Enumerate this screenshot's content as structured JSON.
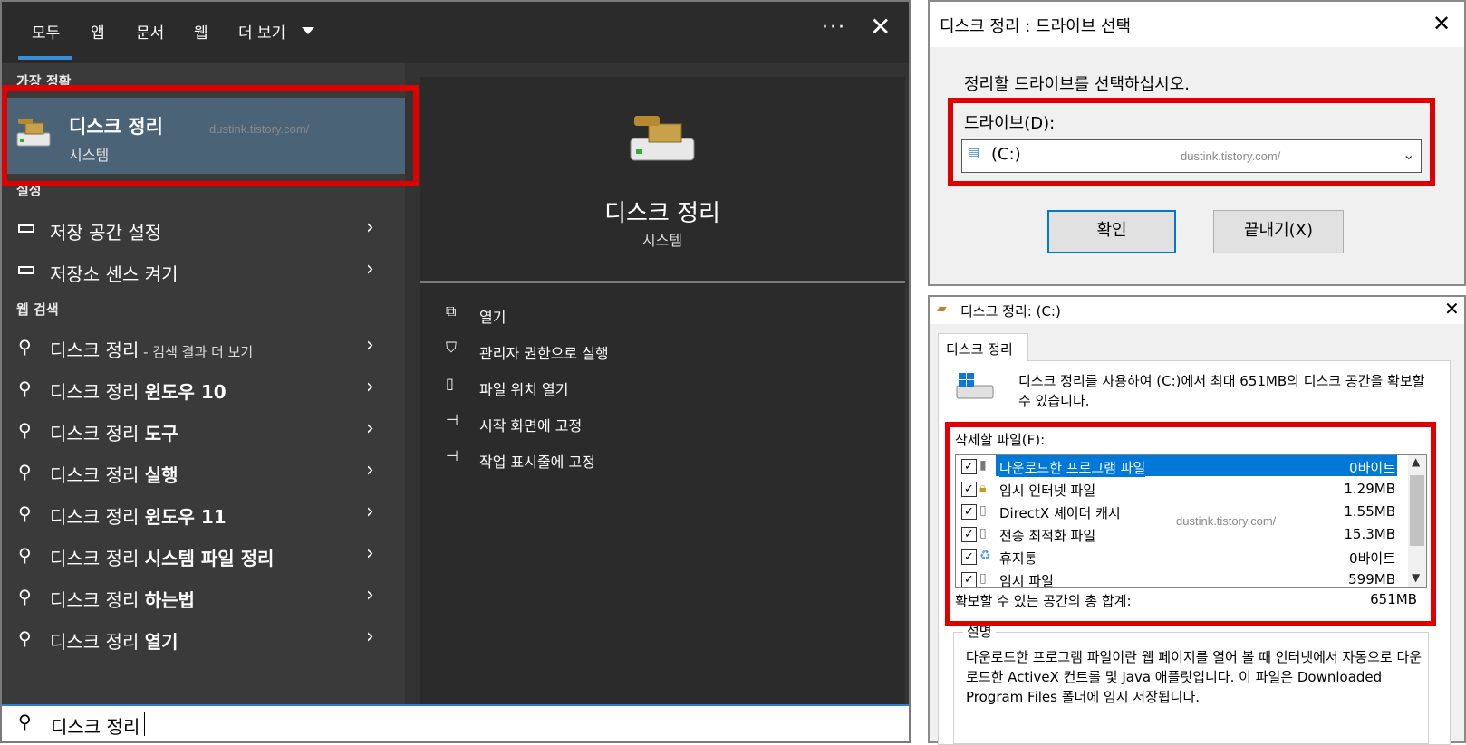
{
  "search": {
    "tabs": [
      "모두",
      "앱",
      "문서",
      "웹",
      "더 보기"
    ],
    "ellipsis": "···",
    "close": "✕",
    "best_match_header": "가장 정확",
    "best_match": {
      "title": "디스크 정리",
      "subtitle": "시스템",
      "watermark": "dustink.tistory.com/"
    },
    "settings_header": "설정",
    "settings_items": [
      "저장 공간 설정",
      "저장소 센스 켜기"
    ],
    "web_header": "웹 검색",
    "web_items": [
      {
        "base": "디스크 정리",
        "suffix": " - 검색 결과 더 보기",
        "bold": ""
      },
      {
        "base": "디스크 정리 ",
        "suffix": "",
        "bold": "윈도우 10"
      },
      {
        "base": "디스크 정리 ",
        "suffix": "",
        "bold": "도구"
      },
      {
        "base": "디스크 정리 ",
        "suffix": "",
        "bold": "실행"
      },
      {
        "base": "디스크 정리 ",
        "suffix": "",
        "bold": "윈도우 11"
      },
      {
        "base": "디스크 정리 ",
        "suffix": "",
        "bold": "시스템 파일 정리"
      },
      {
        "base": "디스크 정리 ",
        "suffix": "",
        "bold": "하는법"
      },
      {
        "base": "디스크 정리 ",
        "suffix": "",
        "bold": "열기"
      }
    ],
    "preview": {
      "title": "디스크 정리",
      "subtitle": "시스템"
    },
    "actions": [
      "열기",
      "관리자 권한으로 실행",
      "파일 위치 열기",
      "시작 화면에 고정",
      "작업 표시줄에 고정"
    ],
    "query": "디스크 정리"
  },
  "drive_dialog": {
    "title": "디스크 정리 : 드라이브 선택",
    "prompt": "정리할 드라이브를 선택하십시오.",
    "drive_label": "드라이브(D):",
    "selected_drive": "(C:)",
    "watermark": "dustink.tistory.com/",
    "ok": "확인",
    "exit": "끝내기(X)"
  },
  "cleanup_dialog": {
    "title": "디스크 정리: (C:)",
    "tab": "디스크 정리",
    "description": "디스크 정리를 사용하여 (C:)에서 최대 651MB의 디스크 공간을 확보할 수 있습니다.",
    "files_label": "삭제할 파일(F):",
    "files": [
      {
        "name": "다운로드한 프로그램 파일",
        "size": "0바이트",
        "checked": true
      },
      {
        "name": "임시 인터넷 파일",
        "size": "1.29MB",
        "checked": true
      },
      {
        "name": "DirectX 셰이더 캐시",
        "size": "1.55MB",
        "checked": true
      },
      {
        "name": "전송 최적화 파일",
        "size": "15.3MB",
        "checked": true
      },
      {
        "name": "휴지통",
        "size": "0바이트",
        "checked": true
      },
      {
        "name": "임시 파일",
        "size": "599MB",
        "checked": true
      }
    ],
    "watermark": "dustink.tistory.com/",
    "total_label": "확보할 수 있는 공간의 총 합계:",
    "total_value": "651MB",
    "group_label": "설명",
    "group_text": "다운로드한 프로그램 파일이란 웹 페이지를 열어 볼 때 인터넷에서 자동으로 다운로드한 ActiveX 컨트롤 및 Java 애플릿입니다. 이 파일은 Downloaded Program Files 폴더에 임시 저장됩니다."
  }
}
